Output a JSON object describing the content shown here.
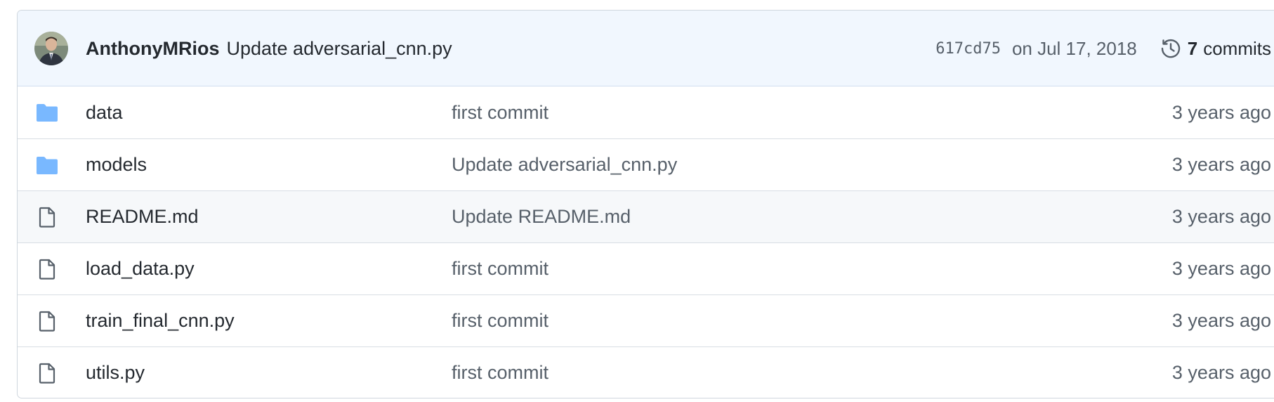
{
  "latest_commit": {
    "author": "AnthonyMRios",
    "message": "Update adversarial_cnn.py",
    "sha": "617cd75",
    "date": "on Jul 17, 2018",
    "commit_count": "7",
    "commits_label": "commits",
    "history_icon": "history-icon",
    "avatar": "author-avatar"
  },
  "files": [
    {
      "icon": "folder-icon",
      "name": "data",
      "message": "first commit",
      "age": "3 years ago"
    },
    {
      "icon": "folder-icon",
      "name": "models",
      "message": "Update adversarial_cnn.py",
      "age": "3 years ago"
    },
    {
      "icon": "file-icon",
      "name": "README.md",
      "message": "Update README.md",
      "age": "3 years ago"
    },
    {
      "icon": "file-icon",
      "name": "load_data.py",
      "message": "first commit",
      "age": "3 years ago"
    },
    {
      "icon": "file-icon",
      "name": "train_final_cnn.py",
      "message": "first commit",
      "age": "3 years ago"
    },
    {
      "icon": "file-icon",
      "name": "utils.py",
      "message": "first commit",
      "age": "3 years ago"
    }
  ],
  "colors": {
    "header_bg": "#f1f7fe",
    "folder": "#79b8ff",
    "file_icon": "#57606a",
    "hover_row": "#f6f8fa"
  }
}
